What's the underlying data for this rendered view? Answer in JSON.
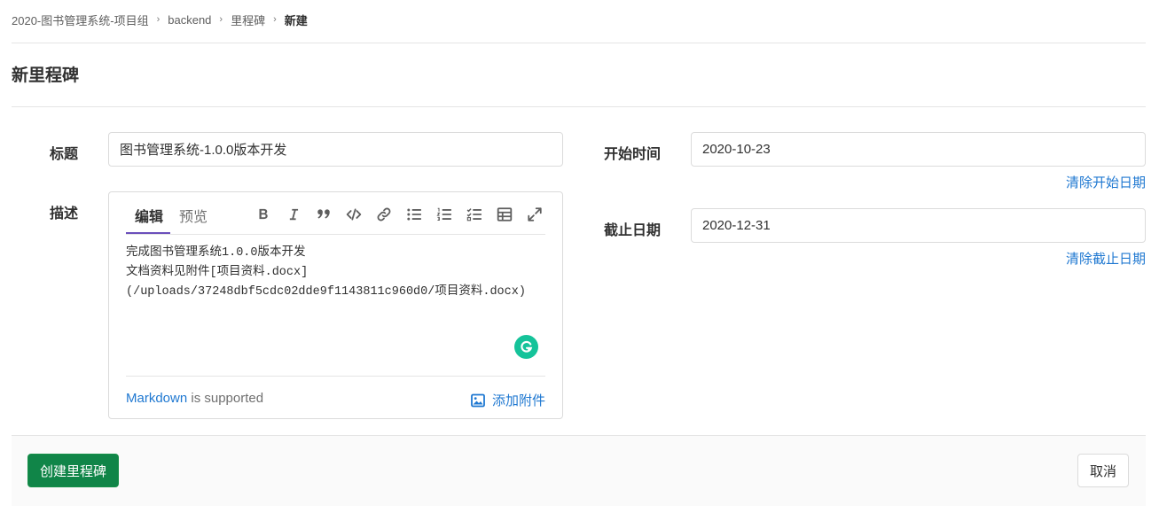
{
  "breadcrumb": {
    "items": [
      "2020-图书管理系统-项目组",
      "backend",
      "里程碑"
    ],
    "current": "新建",
    "separator": "›"
  },
  "page": {
    "title": "新里程碑"
  },
  "form": {
    "title_label": "标题",
    "title_value": "图书管理系统-1.0.0版本开发",
    "description_label": "描述",
    "description_value": "完成图书管理系统1.0.0版本开发\n文档资料见附件[项目资料.docx](/uploads/37248dbf5cdc02dde9f1143811c960d0/项目资料.docx)",
    "start_label": "开始时间",
    "start_value": "2020-10-23",
    "clear_start": "清除开始日期",
    "due_label": "截止日期",
    "due_value": "2020-12-31",
    "clear_due": "清除截止日期"
  },
  "editor": {
    "tab_edit": "编辑",
    "tab_preview": "预览",
    "toolbar_icons": [
      "bold-icon",
      "italic-icon",
      "quote-icon",
      "code-icon",
      "link-icon",
      "bullet-list-icon",
      "numbered-list-icon",
      "task-list-icon",
      "table-icon",
      "fullscreen-icon"
    ],
    "markdown_link": "Markdown",
    "supported_text": " is supported",
    "attach_label": "添加附件"
  },
  "actions": {
    "create": "创建里程碑",
    "cancel": "取消"
  },
  "colors": {
    "accent_link": "#1f78d1",
    "primary_button": "#108548",
    "tab_underline": "#6b4fbb",
    "grammarly": "#15c39a"
  }
}
